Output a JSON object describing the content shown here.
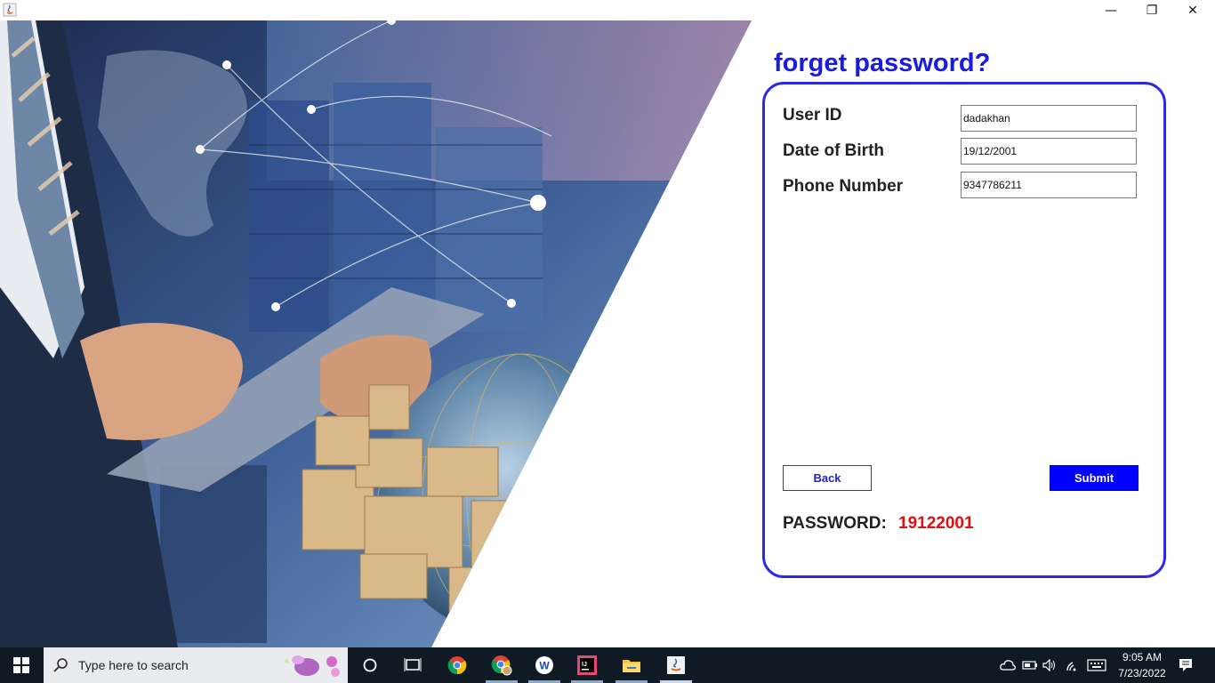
{
  "window": {
    "controls": {
      "minimize": "—",
      "restore": "❐",
      "close": "✕"
    }
  },
  "form": {
    "title": "forget password?",
    "fields": [
      {
        "label": "User ID",
        "value": "dadakhan"
      },
      {
        "label": "Date of Birth",
        "value": "19/12/2001"
      },
      {
        "label": "Phone Number",
        "value": "9347786211"
      }
    ],
    "back_label": "Back",
    "submit_label": "Submit",
    "password_label": "PASSWORD:",
    "password_value": "19122001"
  },
  "hero": {
    "description_icons": [
      "businessman-icon",
      "world-map-icon",
      "globe-icon",
      "boxes-icon"
    ]
  },
  "taskbar": {
    "search_placeholder": "Type here to search",
    "apps": [
      "task-view-icon",
      "chrome-icon",
      "chrome-profile-icon",
      "app-w-icon",
      "intellij-icon",
      "file-explorer-icon",
      "java-icon"
    ],
    "time": "9:05 AM",
    "date": "7/23/2022"
  },
  "colors": {
    "accent": "#2a2ae6",
    "submit": "#0000ff",
    "password": "#e01010",
    "taskbar": "#0f1a24"
  }
}
